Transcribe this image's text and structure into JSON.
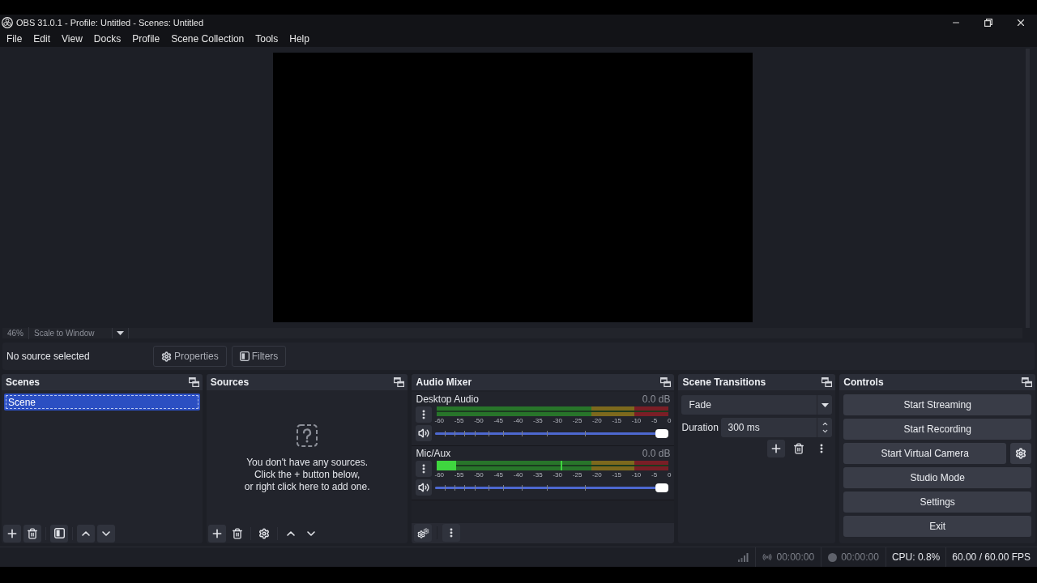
{
  "window": {
    "title": "OBS 31.0.1 - Profile: Untitled - Scenes: Untitled"
  },
  "menu": [
    {
      "label": "File"
    },
    {
      "label": "Edit"
    },
    {
      "label": "View"
    },
    {
      "label": "Docks"
    },
    {
      "label": "Profile"
    },
    {
      "label": "Scene Collection"
    },
    {
      "label": "Tools"
    },
    {
      "label": "Help"
    }
  ],
  "preview": {
    "zoom": "46%",
    "scale_mode": "Scale to Window"
  },
  "context_bar": {
    "status": "No source selected",
    "buttons": [
      {
        "kind": "properties",
        "label": "Properties"
      },
      {
        "kind": "filters",
        "label": "Filters"
      }
    ]
  },
  "scenes": {
    "title": "Scenes",
    "items": [
      {
        "name": "Scene",
        "selected": true
      }
    ]
  },
  "sources": {
    "title": "Sources",
    "empty_message": [
      "You don't have any sources.",
      "Click the + button below,",
      "or right click here to add one."
    ]
  },
  "audio_mixer": {
    "title": "Audio Mixer",
    "channels": [
      {
        "name": "Desktop Audio",
        "reading": "0.0 dB",
        "muted": false,
        "meter": {
          "level": 0
        },
        "ticks": [
          "-60",
          "-55",
          "-50",
          "-45",
          "-40",
          "-35",
          "-30",
          "-25",
          "-20",
          "-15",
          "-10",
          "-5",
          "0"
        ],
        "volume": {
          "level": 1
        }
      },
      {
        "name": "Mic/Aux",
        "reading": "0.0 dB",
        "muted": false,
        "meter": {
          "level": 0.083,
          "peak": {
            "level": 0.535
          }
        },
        "ticks": [
          "-60",
          "-55",
          "-50",
          "-45",
          "-40",
          "-35",
          "-30",
          "-25",
          "-20",
          "-15",
          "-10",
          "-5",
          "0"
        ],
        "volume": {
          "level": 1
        }
      }
    ]
  },
  "scene_transitions": {
    "title": "Scene Transitions",
    "transition": "Fade",
    "duration_label": "Duration",
    "duration": "300 ms"
  },
  "controls": {
    "title": "Controls",
    "buttons": [
      {
        "kind": "plain",
        "label": "Start Streaming"
      },
      {
        "kind": "plain",
        "label": "Start Recording"
      },
      {
        "kind": "with_settings",
        "label": "Start Virtual Camera"
      },
      {
        "kind": "plain",
        "label": "Studio Mode"
      },
      {
        "kind": "plain",
        "label": "Settings"
      },
      {
        "kind": "plain",
        "label": "Exit"
      }
    ]
  },
  "status_bar": {
    "stream": {
      "active": false,
      "time": "00:00:00"
    },
    "record": {
      "active": false,
      "time": "00:00:00"
    },
    "cpu": "CPU: 0.8%",
    "fps": "60.00 / 60.00 FPS"
  }
}
